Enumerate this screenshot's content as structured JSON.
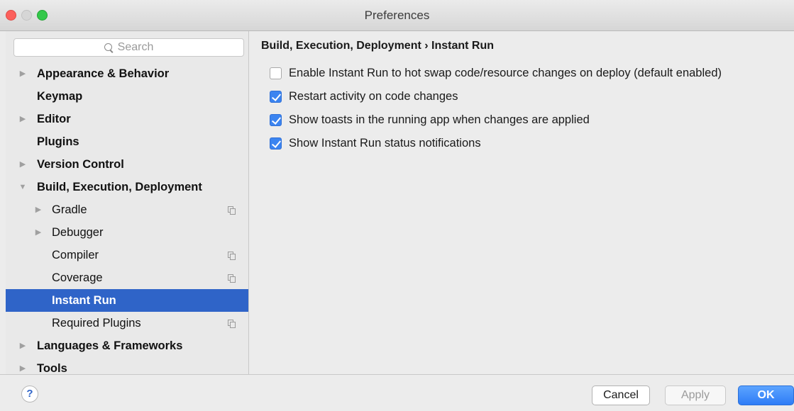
{
  "window": {
    "title": "Preferences"
  },
  "search": {
    "placeholder": "Search"
  },
  "tree": [
    {
      "label": "Appearance & Behavior",
      "expanded": false
    },
    {
      "label": "Keymap"
    },
    {
      "label": "Editor",
      "expanded": false
    },
    {
      "label": "Plugins"
    },
    {
      "label": "Version Control",
      "expanded": false
    },
    {
      "label": "Build, Execution, Deployment",
      "expanded": true
    },
    {
      "label": "Gradle",
      "expanded": false
    },
    {
      "label": "Debugger",
      "expanded": false
    },
    {
      "label": "Compiler"
    },
    {
      "label": "Coverage"
    },
    {
      "label": "Instant Run",
      "selected": true
    },
    {
      "label": "Required Plugins"
    },
    {
      "label": "Languages & Frameworks",
      "expanded": false
    },
    {
      "label": "Tools",
      "expanded": false
    }
  ],
  "content": {
    "breadcrumb": "Build, Execution, Deployment › Instant Run",
    "options": [
      {
        "label": "Enable Instant Run to hot swap code/resource changes on deploy (default enabled)",
        "checked": false
      },
      {
        "label": "Restart activity on code changes",
        "checked": true
      },
      {
        "label": "Show toasts in the running app when changes are applied",
        "checked": true
      },
      {
        "label": "Show Instant Run status notifications",
        "checked": true
      }
    ]
  },
  "buttons": {
    "help": "?",
    "cancel": "Cancel",
    "apply": "Apply",
    "ok": "OK"
  },
  "colors": {
    "selection": "#2f64c8",
    "checkbox_on": "#3b84f0",
    "ok_button": "#2e7cf6"
  }
}
